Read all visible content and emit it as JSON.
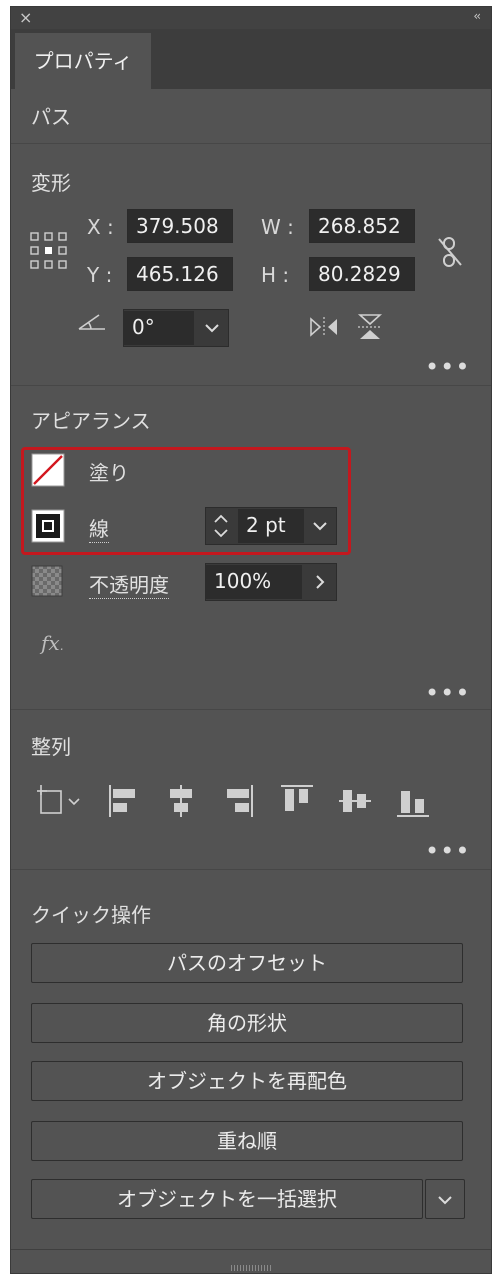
{
  "window": {
    "close": "×",
    "collapse": "‹‹"
  },
  "tab": {
    "label": "プロパティ"
  },
  "sections": {
    "path": "パス",
    "transform": "変形",
    "appearance": "アピアランス",
    "align": "整列",
    "quick": "クイック操作"
  },
  "transform": {
    "x_label": "X :",
    "x_value": "379.508",
    "y_label": "Y :",
    "y_value": "465.126",
    "w_label": "W :",
    "w_value": "268.852",
    "h_label": "H :",
    "h_value": "80.2829",
    "angle_value": "0°"
  },
  "appearance": {
    "fill_label": "塗り",
    "stroke_label": "線",
    "stroke_value": "2 pt",
    "opacity_label": "不透明度",
    "opacity_value": "100%",
    "fx_label": "fx"
  },
  "more": "•••",
  "quick_actions": [
    "パスのオフセット",
    "角の形状",
    "オブジェクトを再配色",
    "重ね順",
    "オブジェクトを一括選択"
  ],
  "colors": {
    "highlight": "#c4181e",
    "panel": "#535353",
    "field": "#2c2c2c"
  }
}
